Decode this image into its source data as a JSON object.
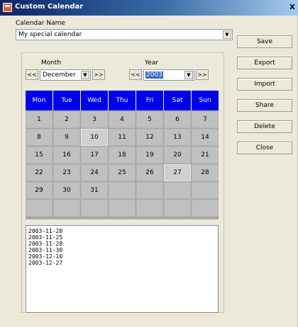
{
  "window": {
    "title": "Custom Calendar",
    "close_label": "X"
  },
  "calendar_name": {
    "label": "Calendar Name",
    "value": "My special calendar"
  },
  "buttons": [
    "Save",
    "Export",
    "Import",
    "Share",
    "Delete",
    "Close"
  ],
  "month": {
    "label": "Month",
    "prev": "<<",
    "next": ">>",
    "value": "December"
  },
  "year": {
    "label": "Year",
    "prev": "<<",
    "next": ">>",
    "value": "2003"
  },
  "weekdays": [
    "Mon",
    "Tue",
    "Wed",
    "Thu",
    "Fri",
    "Sat",
    "Sun"
  ],
  "weeks": [
    [
      "1",
      "2",
      "3",
      "4",
      "5",
      "6",
      "7"
    ],
    [
      "8",
      "9",
      "10",
      "11",
      "12",
      "13",
      "14"
    ],
    [
      "15",
      "16",
      "17",
      "18",
      "19",
      "20",
      "21"
    ],
    [
      "22",
      "23",
      "24",
      "25",
      "26",
      "27",
      "28"
    ],
    [
      "29",
      "30",
      "31",
      "",
      "",
      "",
      ""
    ],
    [
      "",
      "",
      "",
      "",
      "",
      "",
      ""
    ]
  ],
  "flagged_days": [
    "10",
    "27"
  ],
  "selected_dates": [
    "2003-11-20",
    "2003-11-25",
    "2003-11-28",
    "2003-11-30",
    "2003-12-10",
    "2003-12-27"
  ]
}
